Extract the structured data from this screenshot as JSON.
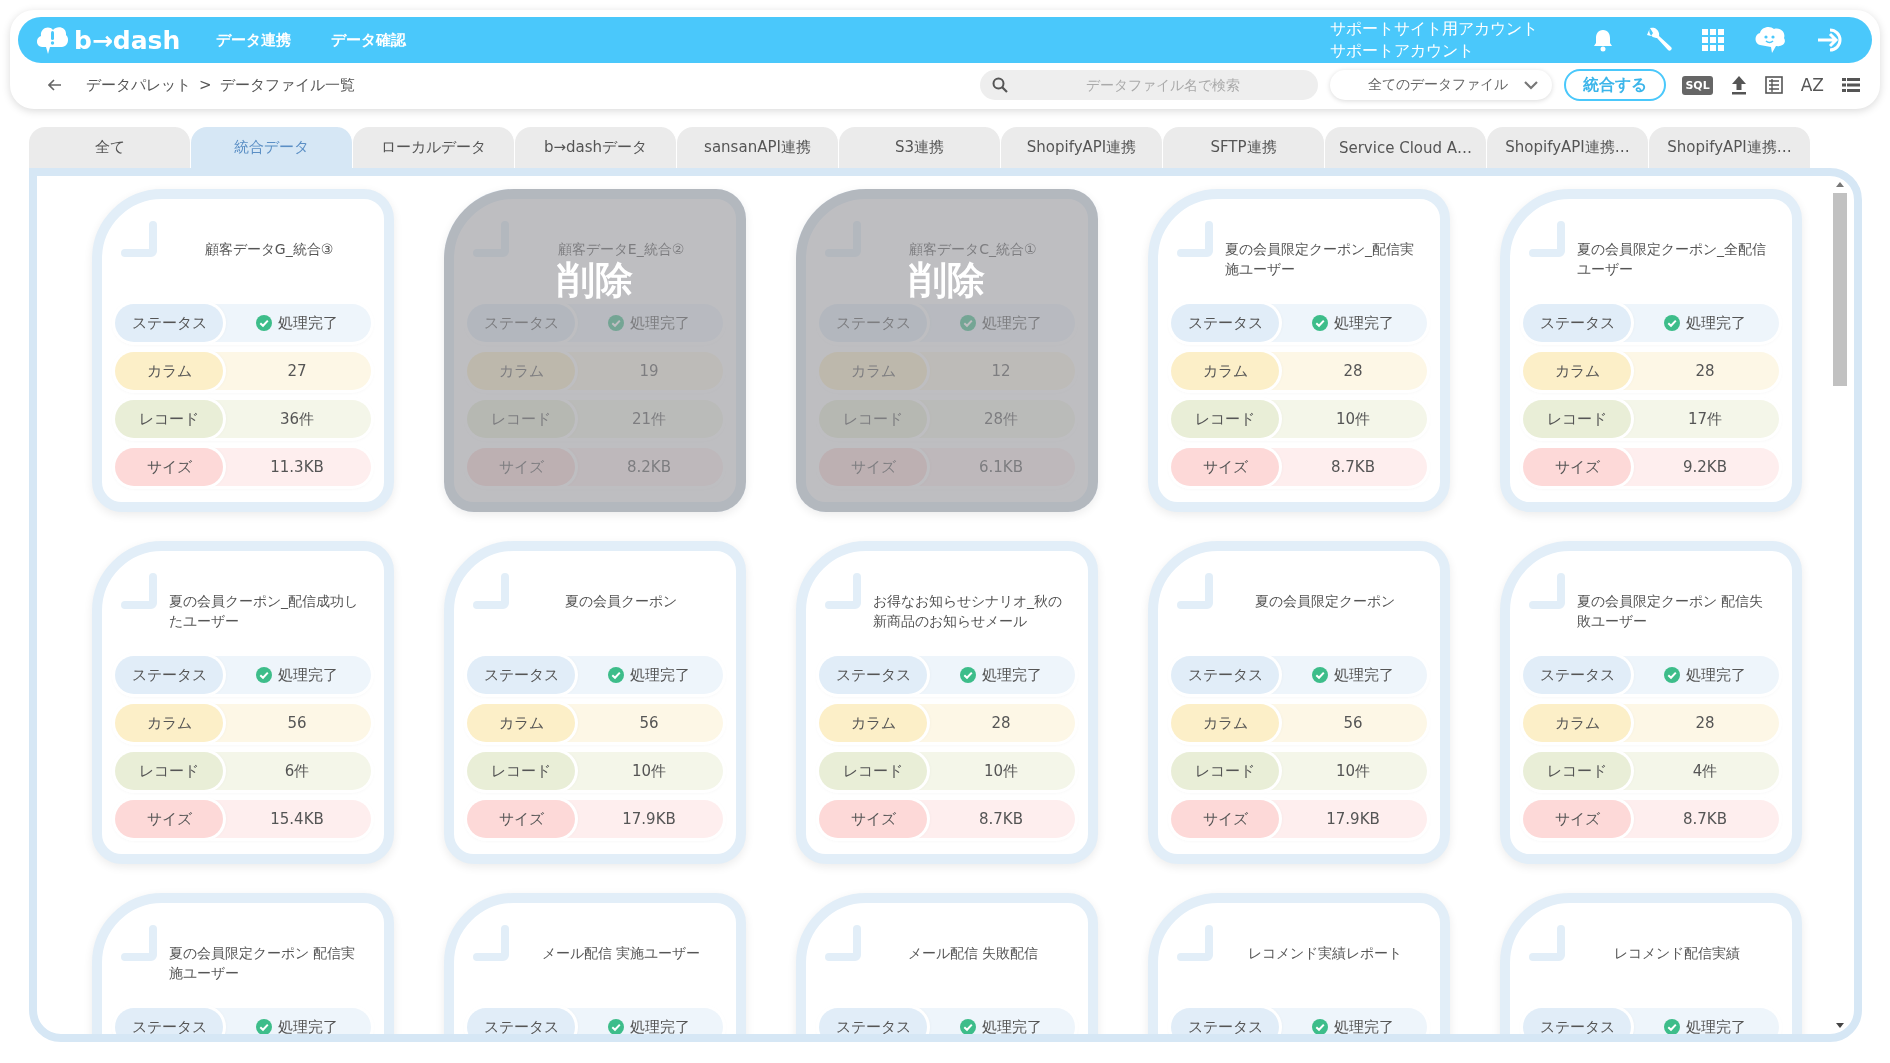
{
  "header": {
    "logo": "b→dash",
    "nav": [
      "データ連携",
      "データ確認"
    ],
    "account": [
      "サポートサイト用アカウント",
      "サポートアカウント"
    ]
  },
  "breadcrumb": {
    "items": [
      "データパレット",
      "データファイル一覧"
    ],
    "separator": ">"
  },
  "toolbar": {
    "search": {
      "placeholder": "データファイル名で検索"
    },
    "filter": {
      "value": "全てのデータファイル"
    },
    "merge_button": "統合する",
    "sql_label": "SQL",
    "sort_label": "AZ"
  },
  "tabs": [
    {
      "label": "全て",
      "selected": false
    },
    {
      "label": "統合データ",
      "selected": true
    },
    {
      "label": "ローカルデータ",
      "selected": false
    },
    {
      "label": "b→dashデータ",
      "selected": false
    },
    {
      "label": "sansanAPI連携",
      "selected": false
    },
    {
      "label": "S3連携",
      "selected": false
    },
    {
      "label": "ShopifyAPI連携",
      "selected": false
    },
    {
      "label": "SFTP連携",
      "selected": false
    },
    {
      "label": "Service Cloud A…",
      "selected": false
    },
    {
      "label": "ShopifyAPI連携…",
      "selected": false
    },
    {
      "label": "ShopifyAPI連携…",
      "selected": false
    }
  ],
  "cards": [
    {
      "title": "顧客データG_統合③",
      "deleted": false,
      "rows": [
        {
          "kind": "status",
          "label": "ステータス",
          "value": "処理完了"
        },
        {
          "kind": "columns",
          "label": "カラム",
          "value": "27"
        },
        {
          "kind": "records",
          "label": "レコード",
          "value": "36件"
        },
        {
          "kind": "size",
          "label": "サイズ",
          "value": "11.3KB"
        }
      ]
    },
    {
      "title": "顧客データE_統合②",
      "deleted": true,
      "overlay": "削除",
      "rows": [
        {
          "kind": "status",
          "label": "ステータス",
          "value": "処理完了"
        },
        {
          "kind": "columns",
          "label": "カラム",
          "value": "19"
        },
        {
          "kind": "records",
          "label": "レコード",
          "value": "21件"
        },
        {
          "kind": "size",
          "label": "サイズ",
          "value": "8.2KB"
        }
      ]
    },
    {
      "title": "顧客データC_統合①",
      "deleted": true,
      "overlay": "削除",
      "rows": [
        {
          "kind": "status",
          "label": "ステータス",
          "value": "処理完了"
        },
        {
          "kind": "columns",
          "label": "カラム",
          "value": "12"
        },
        {
          "kind": "records",
          "label": "レコード",
          "value": "28件"
        },
        {
          "kind": "size",
          "label": "サイズ",
          "value": "6.1KB"
        }
      ]
    },
    {
      "title": "夏の会員限定クーポン_配信実施ユーザー",
      "deleted": false,
      "rows": [
        {
          "kind": "status",
          "label": "ステータス",
          "value": "処理完了"
        },
        {
          "kind": "columns",
          "label": "カラム",
          "value": "28"
        },
        {
          "kind": "records",
          "label": "レコード",
          "value": "10件"
        },
        {
          "kind": "size",
          "label": "サイズ",
          "value": "8.7KB"
        }
      ]
    },
    {
      "title": "夏の会員限定クーポン_全配信ユーザー",
      "deleted": false,
      "rows": [
        {
          "kind": "status",
          "label": "ステータス",
          "value": "処理完了"
        },
        {
          "kind": "columns",
          "label": "カラム",
          "value": "28"
        },
        {
          "kind": "records",
          "label": "レコード",
          "value": "17件"
        },
        {
          "kind": "size",
          "label": "サイズ",
          "value": "9.2KB"
        }
      ]
    },
    {
      "title": "夏の会員クーポン_配信成功したユーザー",
      "deleted": false,
      "rows": [
        {
          "kind": "status",
          "label": "ステータス",
          "value": "処理完了"
        },
        {
          "kind": "columns",
          "label": "カラム",
          "value": "56"
        },
        {
          "kind": "records",
          "label": "レコード",
          "value": "6件"
        },
        {
          "kind": "size",
          "label": "サイズ",
          "value": "15.4KB"
        }
      ]
    },
    {
      "title": "夏の会員クーポン",
      "deleted": false,
      "rows": [
        {
          "kind": "status",
          "label": "ステータス",
          "value": "処理完了"
        },
        {
          "kind": "columns",
          "label": "カラム",
          "value": "56"
        },
        {
          "kind": "records",
          "label": "レコード",
          "value": "10件"
        },
        {
          "kind": "size",
          "label": "サイズ",
          "value": "17.9KB"
        }
      ]
    },
    {
      "title": "お得なお知らせシナリオ_秋の新商品のお知らせメール",
      "deleted": false,
      "rows": [
        {
          "kind": "status",
          "label": "ステータス",
          "value": "処理完了"
        },
        {
          "kind": "columns",
          "label": "カラム",
          "value": "28"
        },
        {
          "kind": "records",
          "label": "レコード",
          "value": "10件"
        },
        {
          "kind": "size",
          "label": "サイズ",
          "value": "8.7KB"
        }
      ]
    },
    {
      "title": "夏の会員限定クーポン",
      "deleted": false,
      "rows": [
        {
          "kind": "status",
          "label": "ステータス",
          "value": "処理完了"
        },
        {
          "kind": "columns",
          "label": "カラム",
          "value": "56"
        },
        {
          "kind": "records",
          "label": "レコード",
          "value": "10件"
        },
        {
          "kind": "size",
          "label": "サイズ",
          "value": "17.9KB"
        }
      ]
    },
    {
      "title": "夏の会員限定クーポン 配信失敗ユーザー",
      "deleted": false,
      "rows": [
        {
          "kind": "status",
          "label": "ステータス",
          "value": "処理完了"
        },
        {
          "kind": "columns",
          "label": "カラム",
          "value": "28"
        },
        {
          "kind": "records",
          "label": "レコード",
          "value": "4件"
        },
        {
          "kind": "size",
          "label": "サイズ",
          "value": "8.7KB"
        }
      ]
    },
    {
      "title": "夏の会員限定クーポン 配信実施ユーザー",
      "deleted": false,
      "rows": [
        {
          "kind": "status",
          "label": "ステータス",
          "value": "処理完了"
        }
      ]
    },
    {
      "title": "メール配信 実施ユーザー",
      "deleted": false,
      "rows": [
        {
          "kind": "status",
          "label": "ステータス",
          "value": "処理完了"
        }
      ]
    },
    {
      "title": "メール配信 失敗配信",
      "deleted": false,
      "rows": [
        {
          "kind": "status",
          "label": "ステータス",
          "value": "処理完了"
        }
      ]
    },
    {
      "title": "レコメンド実績レポート",
      "deleted": false,
      "rows": [
        {
          "kind": "status",
          "label": "ステータス",
          "value": "処理完了"
        }
      ]
    },
    {
      "title": "レコメンド配信実績",
      "deleted": false,
      "rows": [
        {
          "kind": "status",
          "label": "ステータス",
          "value": "処理完了"
        }
      ]
    }
  ]
}
